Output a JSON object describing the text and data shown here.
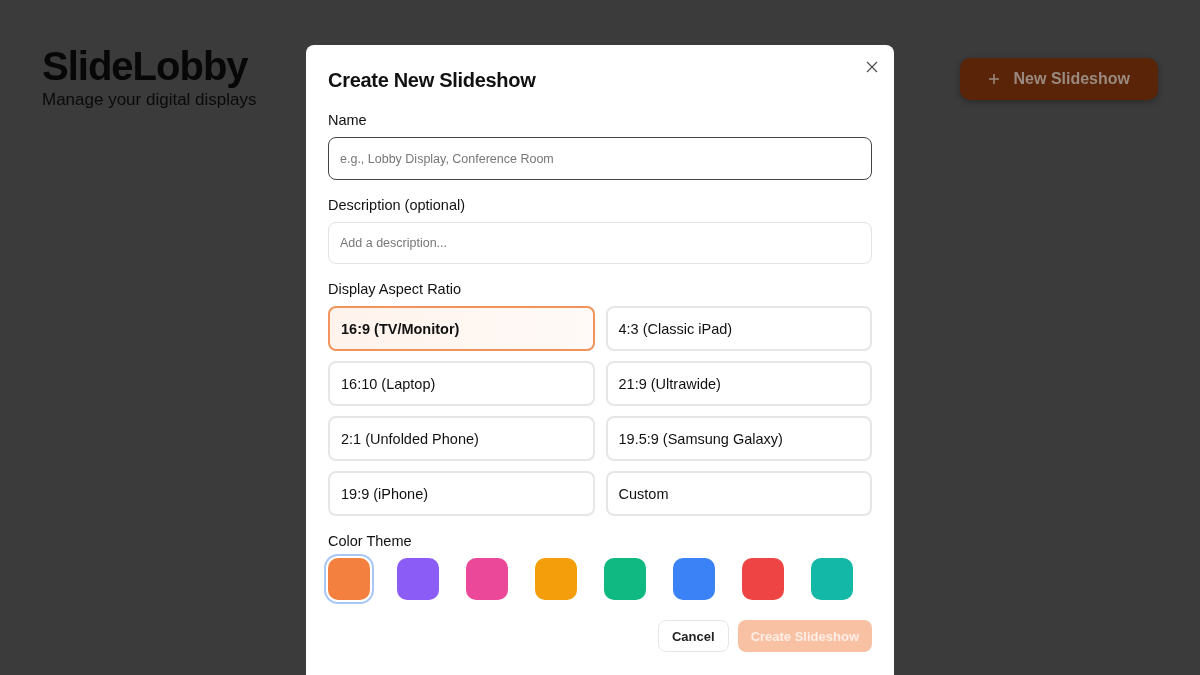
{
  "app": {
    "title": "SlideLobby",
    "subtitle": "Manage your digital displays",
    "new_button": {
      "label": "New Slideshow"
    }
  },
  "dialog": {
    "title": "Create New Slideshow",
    "name_field": {
      "label": "Name",
      "placeholder": "e.g., Lobby Display, Conference Room",
      "focused": true
    },
    "description_field": {
      "label": "Description (optional)",
      "placeholder": "Add a description...",
      "focused": false
    },
    "aspect_label": "Display Aspect Ratio",
    "aspect_ratios": [
      {
        "label": "16:9 (TV/Monitor)",
        "selected": true
      },
      {
        "label": "4:3 (Classic iPad)",
        "selected": false
      },
      {
        "label": "16:10 (Laptop)",
        "selected": false
      },
      {
        "label": "21:9 (Ultrawide)",
        "selected": false
      },
      {
        "label": "2:1 (Unfolded Phone)",
        "selected": false
      },
      {
        "label": "19.5:9 (Samsung Galaxy)",
        "selected": false
      },
      {
        "label": "19:9 (iPhone)",
        "selected": false
      },
      {
        "label": "Custom",
        "selected": false
      }
    ],
    "color_label": "Color Theme",
    "colors": [
      {
        "color": "#f48040",
        "selected": true
      },
      {
        "color": "#8b5cf6",
        "selected": false
      },
      {
        "color": "#ec4899",
        "selected": false
      },
      {
        "color": "#f59e0b",
        "selected": false
      },
      {
        "color": "#10b981",
        "selected": false
      },
      {
        "color": "#3b82f6",
        "selected": false
      },
      {
        "color": "#ef4444",
        "selected": false
      },
      {
        "color": "#14b8a6",
        "selected": false
      }
    ],
    "buttons": [
      {
        "label": "Cancel",
        "kind": "secondary",
        "disabled": false
      },
      {
        "label": "Create Slideshow",
        "kind": "primary",
        "disabled": true
      }
    ]
  }
}
